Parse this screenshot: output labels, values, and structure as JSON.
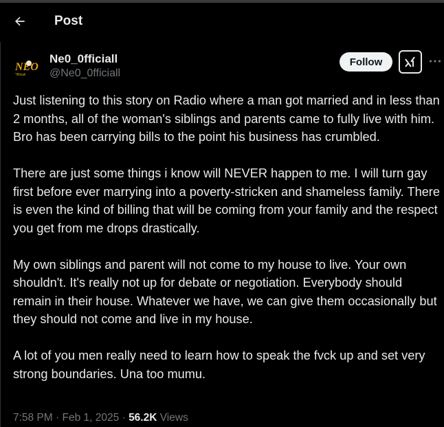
{
  "header": {
    "back_icon": "arrow-left-icon",
    "title": "Post"
  },
  "author": {
    "name": "Ne0_0fficiall",
    "handle": "@Ne0_0fficiall",
    "avatar_text": "NEO"
  },
  "actions": {
    "follow_label": "Follow",
    "grok_icon": "grok-icon",
    "more_icon": "more-dots-icon"
  },
  "tweet": {
    "paragraphs": [
      "Just listening to this story on Radio where a man got married and in less than 2 months, all of the woman's siblings and parents came to fully live with him. Bro has been carrying bills to the point his business has crumbled.",
      "There are just some things i know will NEVER happen to me. I will turn gay first before ever marrying into a poverty-stricken and shameless family. There is even the kind of billing that will be coming from your family and the respect you get from me drops drastically.",
      "My own siblings and parent will not come to my house to live. Your own shouldn't. It's really not up for debate or negotiation. Everybody should remain in their house. Whatever we have, we can give them occasionally but they should not come and live in my house.",
      "A lot of you men really need to learn how to speak the fvck up and set very strong boundaries. Una too mumu."
    ]
  },
  "meta": {
    "time": "7:58 PM",
    "separator": "·",
    "date": "Feb 1, 2025",
    "views_count": "56.2K",
    "views_label": "Views"
  },
  "colors": {
    "background": "#000000",
    "text": "#e7e9ea",
    "muted": "#71767b",
    "follow_bg": "#eff3f4"
  }
}
